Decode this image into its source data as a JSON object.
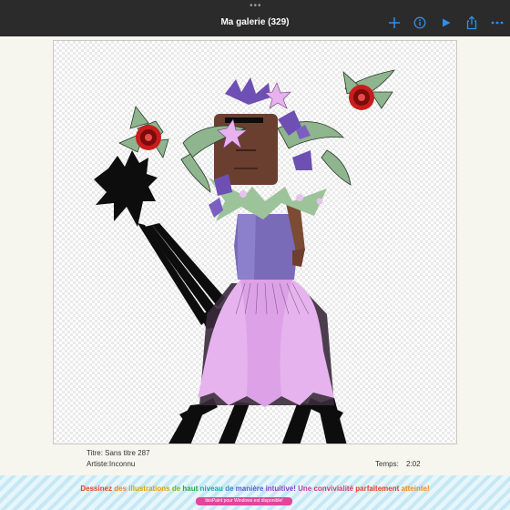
{
  "topbar": {
    "title": "Ma galerie (329)",
    "icons": [
      "add-icon",
      "info-icon",
      "play-icon",
      "share-icon",
      "more-icon"
    ],
    "accent": "#2f8fe8",
    "background": "#2b2b2b"
  },
  "artwork": {
    "title_line": "Titre: Sans titre 287",
    "artist_line": "Artiste:Inconnu",
    "time_label": "Temps:",
    "time_value": "2:02"
  },
  "banner": {
    "headline_parts": [
      {
        "text": "Dessinez ",
        "color": "#e8431f"
      },
      {
        "text": "des ",
        "color": "#ef8a1d"
      },
      {
        "text": "illustrations ",
        "color": "#d9a400"
      },
      {
        "text": "de ",
        "color": "#7bb51e"
      },
      {
        "text": "haut ",
        "color": "#2aa84a"
      },
      {
        "text": "niveau ",
        "color": "#1fa6a0"
      },
      {
        "text": "de ",
        "color": "#2a86d6"
      },
      {
        "text": "manière ",
        "color": "#4f5fd3"
      },
      {
        "text": "intuitive! ",
        "color": "#8b43c9"
      },
      {
        "text": "Une ",
        "color": "#c53fa8"
      },
      {
        "text": "convivialité ",
        "color": "#d33b6e"
      },
      {
        "text": "parfaitement ",
        "color": "#e8431f"
      },
      {
        "text": "atteinte!",
        "color": "#ef8a1d"
      }
    ],
    "pill_text": "ibisPaint pour Windows est disponible!"
  }
}
